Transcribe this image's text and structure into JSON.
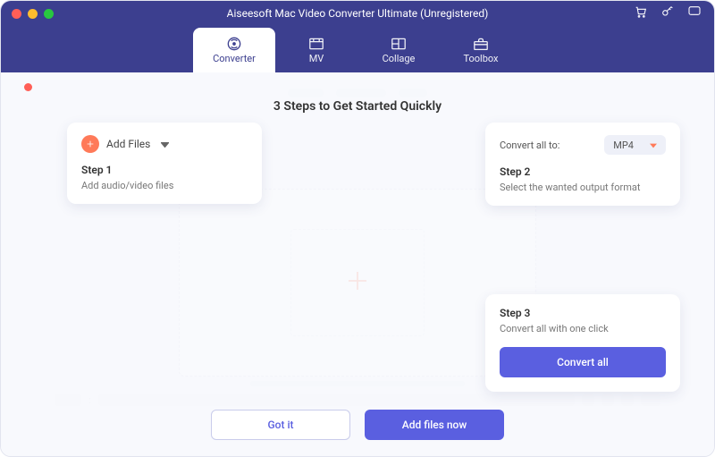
{
  "app_title": "Aiseesoft Mac Video Converter Ultimate (Unregistered)",
  "tabs": {
    "converter": "Converter",
    "mv": "MV",
    "collage": "Collage",
    "toolbox": "Toolbox"
  },
  "overlay": {
    "title": "3 Steps to Get Started Quickly",
    "step1": {
      "add_label": "Add Files",
      "label": "Step 1",
      "desc": "Add audio/video files"
    },
    "step2": {
      "convert_to_label": "Convert all to:",
      "format": "MP4",
      "label": "Step 2",
      "desc": "Select the wanted output format"
    },
    "step3": {
      "label": "Step 3",
      "desc": "Convert all with one click",
      "button": "Convert all"
    },
    "buttons": {
      "got_it": "Got it",
      "add_now": "Add files now"
    }
  }
}
